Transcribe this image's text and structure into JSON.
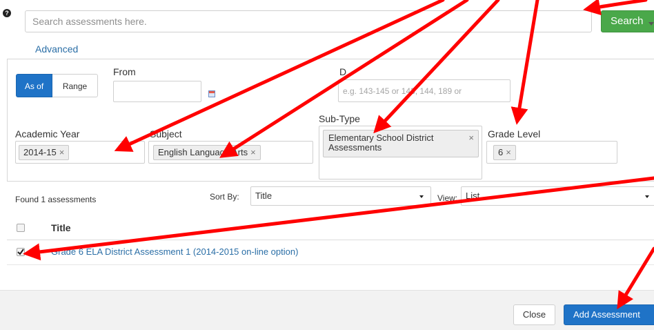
{
  "search": {
    "placeholder": "Search assessments here.",
    "button_label": "Search",
    "advanced_link": "Advanced"
  },
  "filters": {
    "date_mode": {
      "active": "As of",
      "inactive": "Range"
    },
    "from_label": "From",
    "id_label": "D",
    "id_placeholder": "e.g. 143-145 or 143, 144, 189 or",
    "academic_year": {
      "label": "Academic Year",
      "tokens": [
        "2014-15"
      ]
    },
    "subject": {
      "label": "Subject",
      "tokens": [
        "English Language Arts"
      ]
    },
    "sub_type": {
      "label": "Sub-Type",
      "tokens": [
        "Elementary School District Assessments"
      ]
    },
    "grade_level": {
      "label": "Grade Level",
      "tokens": [
        "6"
      ]
    }
  },
  "results": {
    "found_text": "Found 1 assessments",
    "sort_by_label": "Sort By:",
    "sort_by_value": "Title",
    "view_label": "View:",
    "view_value": "List",
    "columns": [
      "Title"
    ],
    "rows": [
      {
        "title": "Grade 6 ELA District Assessment 1 (2014-2015 on-line option)",
        "checked": true
      }
    ]
  },
  "footer": {
    "close_label": "Close",
    "add_label": "Add Assessment"
  },
  "colors": {
    "search_button": "#4aa84a",
    "primary": "#1f73c7",
    "link": "#2a6ea6",
    "annotation_arrows": "#ff0000"
  },
  "icons": [
    "help-icon",
    "calendar-icon",
    "remove-token-icon",
    "caret-down-icon",
    "checkbox-icon",
    "annotation-arrow"
  ]
}
